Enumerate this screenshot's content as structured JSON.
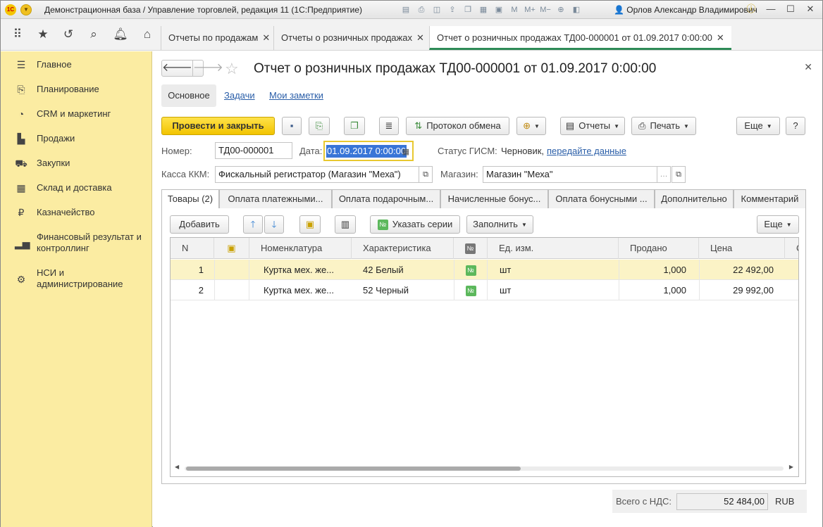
{
  "window": {
    "title": "Демонстрационная база / Управление торговлей, редакция 11  (1С:Предприятие)",
    "user": "Орлов Александр Владимирович"
  },
  "open_tabs": [
    {
      "label": "Отчеты по продажам"
    },
    {
      "label": "Отчеты о розничных продажах"
    },
    {
      "label": "Отчет о розничных продажах ТД00-000001 от 01.09.2017 0:00:00"
    }
  ],
  "sidebar": {
    "items": [
      {
        "label": "Главное",
        "icon": "menu-lines-icon"
      },
      {
        "label": "Планирование",
        "icon": "planning-icon"
      },
      {
        "label": "CRM и маркетинг",
        "icon": "crm-icon"
      },
      {
        "label": "Продажи",
        "icon": "sales-bag-icon"
      },
      {
        "label": "Закупки",
        "icon": "cart-icon"
      },
      {
        "label": "Склад и доставка",
        "icon": "warehouse-icon"
      },
      {
        "label": "Казначейство",
        "icon": "ruble-coin-icon"
      },
      {
        "label": "Финансовый результат и контроллинг",
        "icon": "bar-chart-icon"
      },
      {
        "label": "НСИ и администрирование",
        "icon": "gear-icon"
      }
    ]
  },
  "form": {
    "title": "Отчет о розничных продажах ТД00-000001 от 01.09.2017 0:00:00",
    "subtabs": {
      "main": "Основное",
      "tasks": "Задачи",
      "notes": "Мои заметки"
    },
    "toolbar": {
      "post_close": "Провести и закрыть",
      "exchange_log": "Протокол обмена",
      "reports": "Отчеты",
      "print": "Печать",
      "more": "Еще",
      "help": "?"
    },
    "number_label": "Номер:",
    "number": "ТД00-000001",
    "date_label": "Дата:",
    "date": "01.09.2017  0:00:00",
    "gism_label": "Статус ГИСМ:",
    "gism_status": "Черновик,",
    "gism_link": "передайте данные",
    "kkm_label": "Касса ККМ:",
    "kkm": "Фискальный регистратор (Магазин \"Меха\")",
    "store_label": "Магазин:",
    "store": "Магазин \"Меха\"",
    "tabs": [
      "Товары (2)",
      "Оплата платежными...",
      "Оплата подарочным...",
      "Начисленные бонус...",
      "Оплата бонусными ...",
      "Дополнительно",
      "Комментарий"
    ],
    "goods_toolbar": {
      "add": "Добавить",
      "series": "Указать серии",
      "fill": "Заполнить",
      "more": "Еще"
    },
    "columns": [
      "N",
      "",
      "Номенклатура",
      "Характеристика",
      "№",
      "Ед. изм.",
      "Продано",
      "Цена",
      "С"
    ],
    "rows": [
      {
        "n": "1",
        "item": "Куртка мех. же...",
        "char": "42 Белый",
        "unit": "шт",
        "sold": "1,000",
        "price": "22 492,00"
      },
      {
        "n": "2",
        "item": "Куртка мех. же...",
        "char": "52 Черный",
        "unit": "шт",
        "sold": "1,000",
        "price": "29 992,00"
      }
    ],
    "total_label": "Всего с НДС:",
    "total": "52 484,00",
    "currency": "RUB"
  },
  "colors": {
    "sidebar_bg": "#fbeca2",
    "primary_button": "#f2c400",
    "selected_row": "#fbf3c6",
    "active_tab_underline": "#2e8b57",
    "link": "#2a5ea8"
  }
}
